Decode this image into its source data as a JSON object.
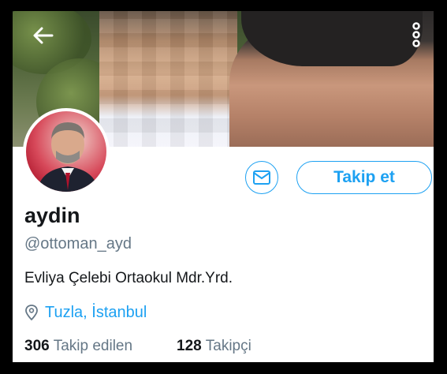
{
  "header": {
    "back_icon": "arrow-left-icon",
    "more_icon": "vertical-dots-icon"
  },
  "profile": {
    "display_name": "aydin",
    "handle": "@ottoman_ayd",
    "bio": "Evliya Çelebi Ortaokul Mdr.Yrd.",
    "location": "Tuzla, İstanbul",
    "location_icon": "location-pin-icon"
  },
  "actions": {
    "message_icon": "envelope-icon",
    "follow_label": "Takip et"
  },
  "stats": {
    "following_count": "306",
    "following_label": "Takip edilen",
    "followers_count": "128",
    "followers_label": "Takipçi"
  },
  "colors": {
    "accent": "#1da1f2",
    "text_primary": "#14171a",
    "text_secondary": "#657786"
  }
}
